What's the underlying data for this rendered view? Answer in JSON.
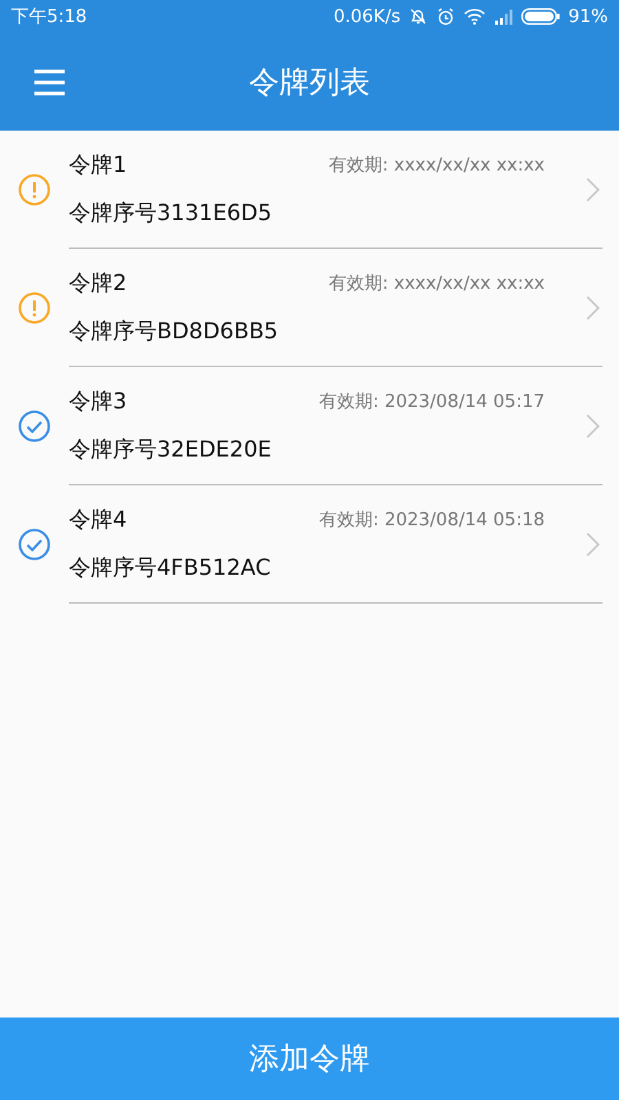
{
  "status_bar": {
    "time": "下午5:18",
    "speed": "0.06K/s",
    "battery": "91%"
  },
  "app_bar": {
    "title": "令牌列表"
  },
  "tokens": [
    {
      "name": "令牌1",
      "serial": "令牌序号3131E6D5",
      "expiry": "有效期: xxxx/xx/xx xx:xx",
      "kind": "warning"
    },
    {
      "name": "令牌2",
      "serial": "令牌序号BD8D6BB5",
      "expiry": "有效期: xxxx/xx/xx xx:xx",
      "kind": "warning"
    },
    {
      "name": "令牌3",
      "serial": "令牌序号32EDE20E",
      "expiry": "有效期: 2023/08/14 05:17",
      "kind": "valid"
    },
    {
      "name": "令牌4",
      "serial": "令牌序号4FB512AC",
      "expiry": "有效期: 2023/08/14 05:18",
      "kind": "valid"
    }
  ],
  "add_button": "添加令牌"
}
